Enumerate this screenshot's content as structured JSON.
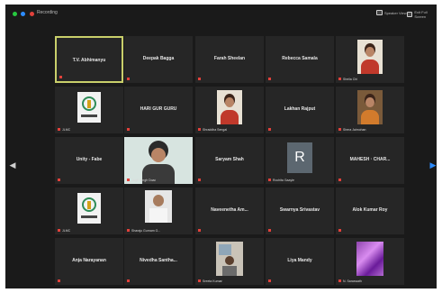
{
  "window": {
    "recording_label": "Recording",
    "view_buttons": [
      "Speaker View",
      "Exit Full Screen"
    ]
  },
  "colors": {
    "active_border": "#c9cf6a",
    "muted_icon": "#e1413b",
    "background": "#1a1a1a",
    "tile": "#262626"
  },
  "participants": [
    {
      "name": "T.V. Abhimanyu",
      "caption": "",
      "type": "name",
      "active": true
    },
    {
      "name": "Deepak Bagga",
      "caption": "",
      "type": "name"
    },
    {
      "name": "Farah Sheelan",
      "caption": "",
      "type": "name"
    },
    {
      "name": "Rebecca Samala",
      "caption": "",
      "type": "name"
    },
    {
      "name": "",
      "caption": "Sheila Chi",
      "type": "photo-woman"
    },
    {
      "name": "",
      "caption": "JLMC",
      "type": "logo"
    },
    {
      "name": "HARI GUR GURU",
      "caption": "",
      "type": "name"
    },
    {
      "name": "",
      "caption": "Shraddha Sengal",
      "type": "photo-woman"
    },
    {
      "name": "Lakhan Rajput",
      "caption": "",
      "type": "name"
    },
    {
      "name": "",
      "caption": "Shera Jaimohan",
      "type": "photo-woman2"
    },
    {
      "name": "Unity - Fabe",
      "caption": "",
      "type": "name"
    },
    {
      "name": "",
      "caption": "Jagjit Singh Doad",
      "type": "photo-man"
    },
    {
      "name": "Saryam Shah",
      "caption": "",
      "type": "name"
    },
    {
      "name": "",
      "caption": "Rochita Gaayle",
      "type": "initial",
      "initial": "R"
    },
    {
      "name": "MAHESH · CHAR...",
      "caption": "",
      "type": "name"
    },
    {
      "name": "",
      "caption": "JLMC",
      "type": "logo"
    },
    {
      "name": "",
      "caption": "Sharaju Gurnam G...",
      "type": "photo-old"
    },
    {
      "name": "Naveenetha Am...",
      "caption": "",
      "type": "name"
    },
    {
      "name": "Swarnya Srivastav",
      "caption": "",
      "type": "name"
    },
    {
      "name": "Alok Kumar Roy",
      "caption": "",
      "type": "name"
    },
    {
      "name": "Anja Narayanan",
      "caption": "",
      "type": "name"
    },
    {
      "name": "Nivedha Santha...",
      "caption": "",
      "type": "name"
    },
    {
      "name": "",
      "caption": "Sreeta Kumari",
      "type": "photo-room"
    },
    {
      "name": "Liya Mandy",
      "caption": "",
      "type": "name"
    },
    {
      "name": "",
      "caption": "N. Saraswath",
      "type": "photo-purple"
    }
  ]
}
